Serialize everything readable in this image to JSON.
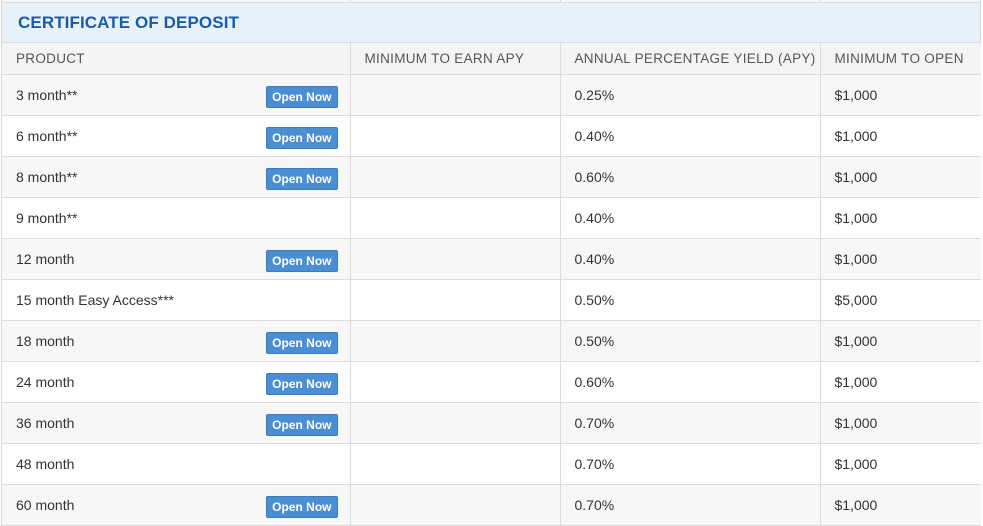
{
  "section": {
    "title": "CERTIFICATE OF DEPOSIT"
  },
  "table": {
    "headers": [
      "PRODUCT",
      "MINIMUM TO EARN APY",
      "ANNUAL PERCENTAGE YIELD (APY)",
      "MINIMUM TO OPEN"
    ],
    "open_now_label": "Open Now",
    "rows": [
      {
        "product": "3 month**",
        "min_earn": "",
        "apy": "0.25%",
        "min_open": "$1,000",
        "open_now": true
      },
      {
        "product": "6 month**",
        "min_earn": "",
        "apy": "0.40%",
        "min_open": "$1,000",
        "open_now": true
      },
      {
        "product": "8 month**",
        "min_earn": "",
        "apy": "0.60%",
        "min_open": "$1,000",
        "open_now": true
      },
      {
        "product": "9 month**",
        "min_earn": "",
        "apy": "0.40%",
        "min_open": "$1,000",
        "open_now": false
      },
      {
        "product": "12 month",
        "min_earn": "",
        "apy": "0.40%",
        "min_open": "$1,000",
        "open_now": true
      },
      {
        "product": "15 month Easy Access***",
        "min_earn": "",
        "apy": "0.50%",
        "min_open": "$5,000",
        "open_now": false
      },
      {
        "product": "18 month",
        "min_earn": "",
        "apy": "0.50%",
        "min_open": "$1,000",
        "open_now": true
      },
      {
        "product": "24 month",
        "min_earn": "",
        "apy": "0.60%",
        "min_open": "$1,000",
        "open_now": true
      },
      {
        "product": "36 month",
        "min_earn": "",
        "apy": "0.70%",
        "min_open": "$1,000",
        "open_now": true
      },
      {
        "product": "48 month",
        "min_earn": "",
        "apy": "0.70%",
        "min_open": "$1,000",
        "open_now": false
      },
      {
        "product": "60 month",
        "min_earn": "",
        "apy": "0.70%",
        "min_open": "$1,000",
        "open_now": true
      }
    ]
  },
  "colors": {
    "title": "#1a5da6",
    "button": "#4a8fd4",
    "header_band": "#e8f0f8"
  }
}
